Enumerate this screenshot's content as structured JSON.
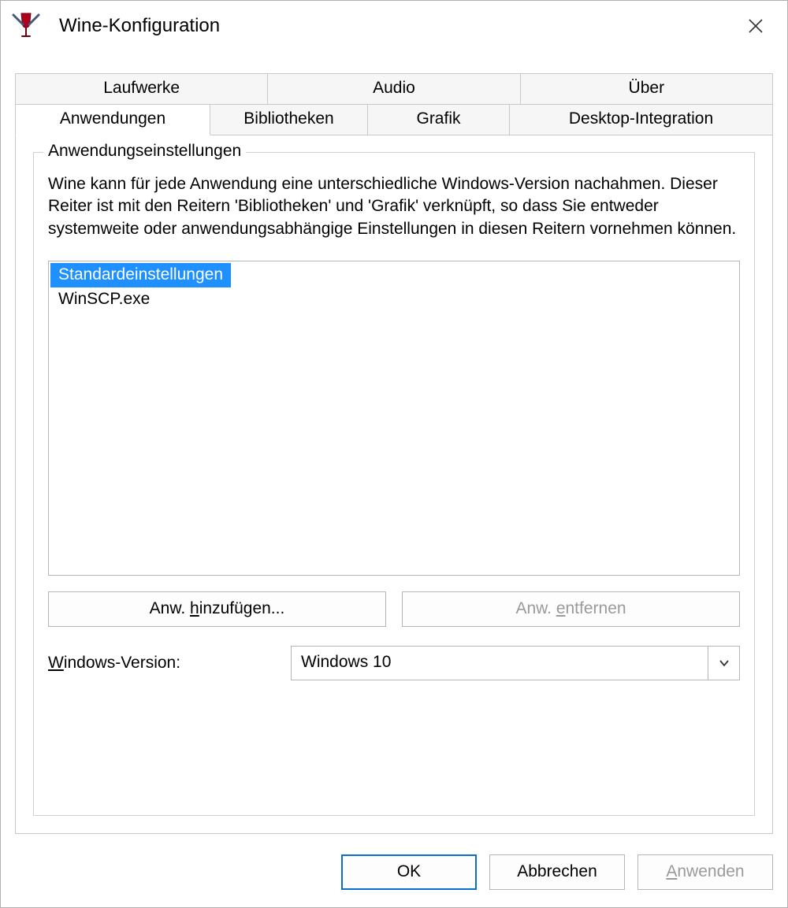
{
  "window": {
    "title": "Wine-Konfiguration"
  },
  "tabs": {
    "row_top": [
      "Laufwerke",
      "Audio",
      "Über"
    ],
    "row_bottom": [
      "Anwendungen",
      "Bibliotheken",
      "Grafik",
      "Desktop-Integration"
    ],
    "active": "Anwendungen"
  },
  "group": {
    "legend": "Anwendungseinstellungen",
    "description": "Wine kann für jede Anwendung eine unterschiedliche Windows-Version nachahmen. Dieser Reiter ist mit den Reitern 'Bibliotheken' und 'Grafik' verknüpft, so dass Sie entweder systemweite oder anwendungsabhängige Einstellungen in diesen Reitern vornehmen können."
  },
  "app_list": {
    "items": [
      "Standardeinstellungen",
      "WinSCP.exe"
    ],
    "selected_index": 0
  },
  "buttons": {
    "add_app_pre": "Anw. ",
    "add_app_mn": "h",
    "add_app_post": "inzufügen...",
    "remove_app_pre": "Anw. ",
    "remove_app_mn": "e",
    "remove_app_post": "ntfernen",
    "remove_app_disabled": true
  },
  "version": {
    "label_mn": "W",
    "label_rest": "indows-Version:",
    "selected": "Windows 10"
  },
  "dialog_buttons": {
    "ok": "OK",
    "cancel": "Abbrechen",
    "apply_mn": "A",
    "apply_rest": "nwenden",
    "apply_disabled": true
  }
}
